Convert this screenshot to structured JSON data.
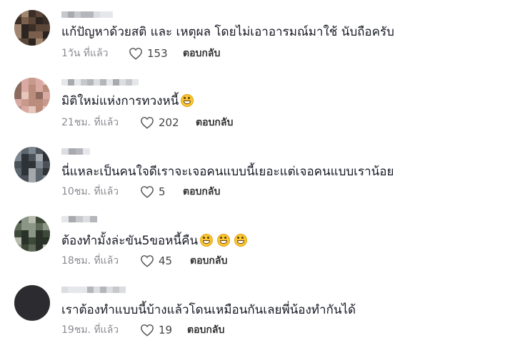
{
  "comments": [
    {
      "text": "แก้ปัญหาด้วยสติ และ เหตุผล โดยไม่เอาอารมณ์มาใช้ นับถือครับ",
      "emoji_count": 0,
      "time": "1วัน ที่แล้ว",
      "likes": "153",
      "reply_label": "ตอบกลับ",
      "avatar_colors": [
        "#5b4638",
        "#7a5f4c",
        "#3b2e26",
        "#a08670",
        "#2c2420"
      ]
    },
    {
      "text": "มิติใหม่แห่งการทวงหนี้",
      "emoji_count": 1,
      "time": "21ชม. ที่แล้ว",
      "likes": "202",
      "reply_label": "ตอบกลับ",
      "avatar_colors": [
        "#d9a9a2",
        "#b98c7c",
        "#e7c6bb",
        "#8c6a5d",
        "#c89a8d"
      ]
    },
    {
      "text": "นี่แหละเป็นคนใจดีเราจะเจอคนแบบนี้เยอะแต่เจอคนแบบเราน้อย",
      "emoji_count": 0,
      "time": "10ชม. ที่แล้ว",
      "likes": "5",
      "reply_label": "ตอบกลับ",
      "avatar_colors": [
        "#4a5158",
        "#7e8790",
        "#2e3338",
        "#a3a9ad",
        "#5d666d"
      ]
    },
    {
      "text": "ต้องทำมั้งล่ะขัน5ขอหนี้คืน",
      "emoji_count": 3,
      "time": "18ชม. ที่แล้ว",
      "likes": "45",
      "reply_label": "ตอบกลับ",
      "avatar_colors": [
        "#3d4a3a",
        "#8c9686",
        "#2a3128",
        "#b7bcae",
        "#5f6a58"
      ]
    },
    {
      "text": "เราต้องทำแบบนี้บ้างแล้วโดนเหมือนกันเลยพี่น้องทำกันได้",
      "emoji_count": 0,
      "time": "19ชม. ที่แล้ว",
      "likes": "19",
      "reply_label": "ตอบกลับ",
      "avatar_colors": [
        "#2c2c30",
        "#6a6a70",
        "#1a1a1e",
        "#9a9aa0",
        "#44444a"
      ]
    }
  ]
}
